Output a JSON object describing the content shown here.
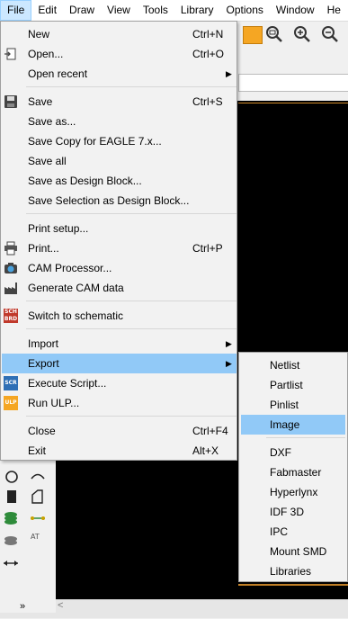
{
  "menubar": {
    "items": [
      "File",
      "Edit",
      "Draw",
      "View",
      "Tools",
      "Library",
      "Options",
      "Window",
      "He"
    ]
  },
  "file_menu": {
    "items": [
      {
        "label": "New",
        "shortcut": "Ctrl+N"
      },
      {
        "label": "Open...",
        "shortcut": "Ctrl+O"
      },
      {
        "label": "Open recent",
        "shortcut": ""
      },
      {
        "label": "Save",
        "shortcut": "Ctrl+S"
      },
      {
        "label": "Save as...",
        "shortcut": ""
      },
      {
        "label": "Save Copy for EAGLE 7.x...",
        "shortcut": ""
      },
      {
        "label": "Save all",
        "shortcut": ""
      },
      {
        "label": "Save as Design Block...",
        "shortcut": ""
      },
      {
        "label": "Save Selection as Design Block...",
        "shortcut": ""
      },
      {
        "label": "Print setup...",
        "shortcut": ""
      },
      {
        "label": "Print...",
        "shortcut": "Ctrl+P"
      },
      {
        "label": "CAM Processor...",
        "shortcut": ""
      },
      {
        "label": "Generate CAM data",
        "shortcut": ""
      },
      {
        "label": "Switch to schematic",
        "shortcut": ""
      },
      {
        "label": "Import",
        "shortcut": ""
      },
      {
        "label": "Export",
        "shortcut": ""
      },
      {
        "label": "Execute Script...",
        "shortcut": ""
      },
      {
        "label": "Run ULP...",
        "shortcut": ""
      },
      {
        "label": "Close",
        "shortcut": "Ctrl+F4"
      },
      {
        "label": "Exit",
        "shortcut": "Alt+X"
      }
    ],
    "icon_text": {
      "sch_top": "SCH",
      "sch_bottom": "BRD",
      "scr": "SCR",
      "ulp": "ULP"
    }
  },
  "export_submenu": {
    "items": [
      "Netlist",
      "Partlist",
      "Pinlist",
      "Image",
      "DXF",
      "Fabmaster",
      "Hyperlynx",
      "IDF 3D",
      "IPC",
      "Mount SMD",
      "Libraries"
    ],
    "selected": "Image"
  },
  "side_tools": {
    "at_label": "AT"
  },
  "colors": {
    "highlight": "#91c9f7",
    "menubar_active": "#cce8ff",
    "canvas": "#000000",
    "accent_orange": "#f5a623"
  }
}
